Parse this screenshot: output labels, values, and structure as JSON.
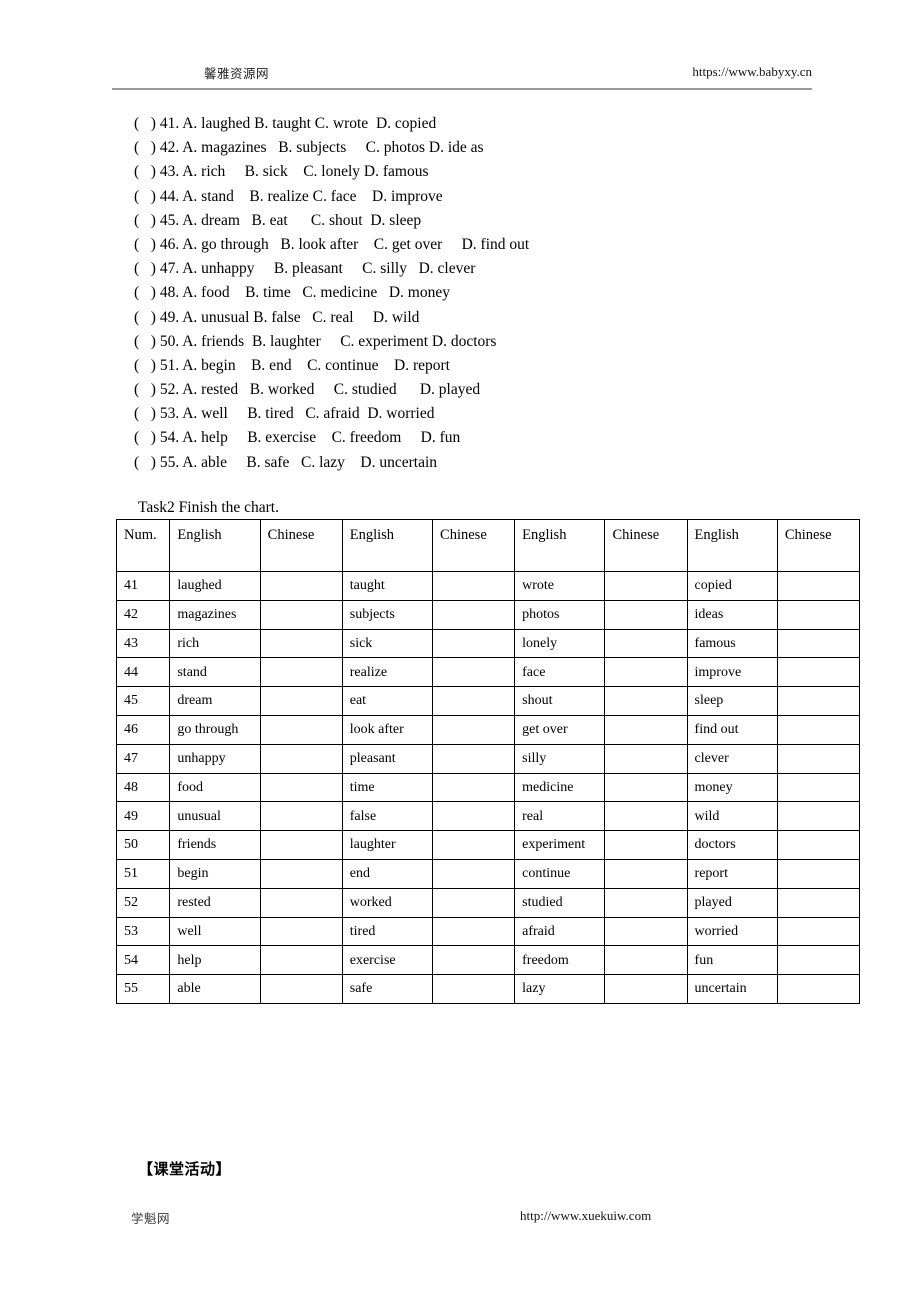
{
  "header": {
    "site_name": "馨雅资源网",
    "url": "https://www.babyxy.cn"
  },
  "questions": [
    "(   ) 41. A. laughed B. taught C. wrote  D. copied",
    "(   ) 42. A. magazines   B. subjects     C. photos D. ide as",
    "(   ) 43. A. rich     B. sick    C. lonely D. famous",
    "(   ) 44. A. stand    B. realize C. face    D. improve",
    "(   ) 45. A. dream   B. eat      C. shout  D. sleep",
    "(   ) 46. A. go through   B. look after    C. get over     D. find out",
    "(   ) 47. A. unhappy     B. pleasant     C. silly   D. clever",
    "(   ) 48. A. food    B. time   C. medicine   D. money",
    "(   ) 49. A. unusual B. false   C. real     D. wild",
    "(   ) 50. A. friends  B. laughter     C. experiment D. doctors",
    "(   ) 51. A. begin    B. end    C. continue    D. report",
    "(   ) 52. A. rested   B. worked     C. studied      D. played",
    "(   ) 53. A. well     B. tired   C. afraid  D. worried",
    "(   ) 54. A. help     B. exercise    C. freedom     D. fun",
    "(   ) 55. A. able     B. safe   C. lazy    D. uncertain"
  ],
  "task2": {
    "label": "Task2 Finish the chart."
  },
  "chart_data": {
    "type": "table",
    "title": "Task2 Finish the chart.",
    "columns": [
      "Num.",
      "English",
      "Chinese",
      "English",
      "Chinese",
      "English",
      "Chinese",
      "English",
      "Chinese"
    ],
    "rows": [
      [
        "41",
        "laughed",
        "",
        "taught",
        "",
        "wrote",
        "",
        "copied",
        ""
      ],
      [
        "42",
        "magazines",
        "",
        "subjects",
        "",
        "photos",
        "",
        "ideas",
        ""
      ],
      [
        "43",
        "rich",
        "",
        "sick",
        "",
        "lonely",
        "",
        "famous",
        ""
      ],
      [
        "44",
        "stand",
        "",
        "realize",
        "",
        "face",
        "",
        "improve",
        ""
      ],
      [
        "45",
        "dream",
        "",
        "eat",
        "",
        "shout",
        "",
        "sleep",
        ""
      ],
      [
        "46",
        "go through",
        "",
        "look after",
        "",
        "get over",
        "",
        "find out",
        ""
      ],
      [
        "47",
        "unhappy",
        "",
        "pleasant",
        "",
        "silly",
        "",
        "clever",
        ""
      ],
      [
        "48",
        "food",
        "",
        "time",
        "",
        "medicine",
        "",
        "money",
        ""
      ],
      [
        "49",
        "unusual",
        "",
        "false",
        "",
        "real",
        "",
        "wild",
        ""
      ],
      [
        "50",
        "friends",
        "",
        "laughter",
        "",
        "experiment",
        "",
        "doctors",
        ""
      ],
      [
        "51",
        "begin",
        "",
        "end",
        "",
        "continue",
        "",
        "report",
        ""
      ],
      [
        "52",
        "rested",
        "",
        "worked",
        "",
        "studied",
        "",
        "played",
        ""
      ],
      [
        "53",
        "well",
        "",
        "tired",
        "",
        "afraid",
        "",
        "worried",
        ""
      ],
      [
        "54",
        "help",
        "",
        "exercise",
        "",
        "freedom",
        "",
        "fun",
        ""
      ],
      [
        "55",
        "able",
        "",
        "safe",
        "",
        "lazy",
        "",
        "uncertain",
        ""
      ]
    ]
  },
  "bottom": {
    "section_title": "【课堂活动】",
    "footer_site": "学魁网",
    "footer_url": "http://www.xuekuiw.com"
  }
}
